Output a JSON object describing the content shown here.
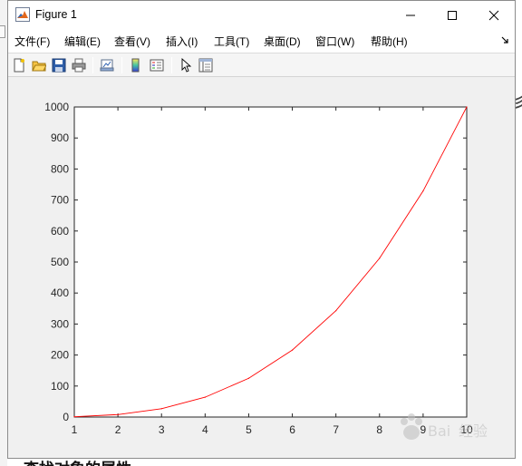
{
  "window": {
    "title": "Figure 1",
    "controls": {
      "minimize": "minimize",
      "maximize": "maximize",
      "close": "close"
    }
  },
  "menu": {
    "items": [
      {
        "label": "文件(F)"
      },
      {
        "label": "编辑(E)"
      },
      {
        "label": "查看(V)"
      },
      {
        "label": "插入(I)"
      },
      {
        "label": "工具(T)"
      },
      {
        "label": "桌面(D)"
      },
      {
        "label": "窗口(W)"
      },
      {
        "label": "帮助(H)"
      }
    ]
  },
  "toolbar": {
    "icons": [
      "new-figure-icon",
      "open-file-icon",
      "save-icon",
      "print-icon",
      "link-plot-icon",
      "colorbar-icon",
      "legend-icon",
      "edit-plot-arrow-icon",
      "property-inspector-icon"
    ]
  },
  "background": {
    "caption": "查找对象的属性",
    "right_glyph": "彡"
  },
  "colors": {
    "line": "#ff0000",
    "axes_bg": "#ffffff",
    "figure_bg": "#f0f0f0"
  },
  "chart_data": {
    "type": "line",
    "title": "",
    "xlabel": "",
    "ylabel": "",
    "x": [
      1,
      2,
      3,
      4,
      5,
      6,
      7,
      8,
      9,
      10
    ],
    "series": [
      {
        "values": [
          1,
          8,
          27,
          64,
          125,
          216,
          343,
          512,
          729,
          1000
        ],
        "color": "#ff0000"
      }
    ],
    "xlim": [
      1,
      10
    ],
    "ylim": [
      0,
      1000
    ],
    "xticks": [
      1,
      2,
      3,
      4,
      5,
      6,
      7,
      8,
      9,
      10
    ],
    "yticks": [
      0,
      100,
      200,
      300,
      400,
      500,
      600,
      700,
      800,
      900,
      1000
    ],
    "grid": false,
    "legend": "none"
  }
}
